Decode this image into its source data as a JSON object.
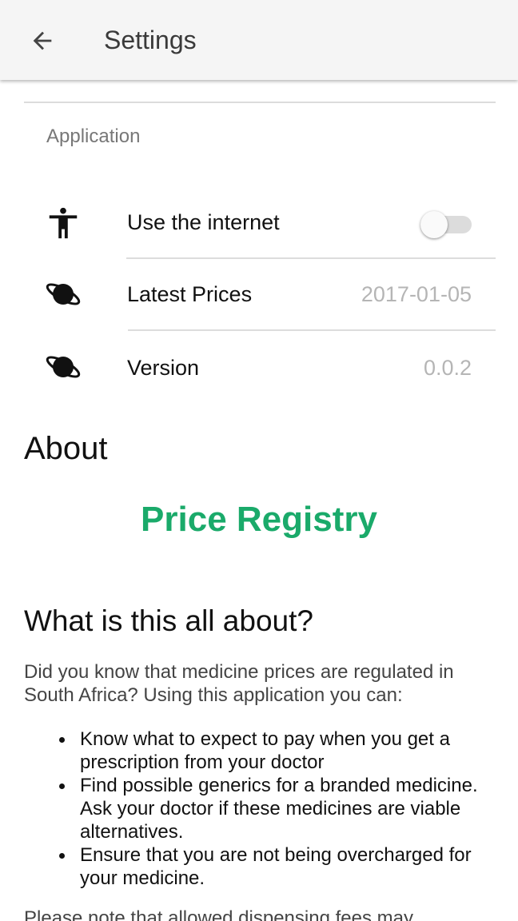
{
  "appbar": {
    "title": "Settings",
    "back_icon": "arrow-left-icon"
  },
  "settings": {
    "section_label": "Application",
    "rows": [
      {
        "label": "Use the internet",
        "icon": "accessibility-icon",
        "control": "toggle",
        "toggle_on": false
      },
      {
        "label": "Latest Prices",
        "icon": "planet-icon",
        "value": "2017-01-05"
      },
      {
        "label": "Version",
        "icon": "planet-icon",
        "value": "0.0.2"
      }
    ]
  },
  "about": {
    "title": "About",
    "brand": "Price Registry",
    "brand_color": "#1aaa6a",
    "what_title": "What is this all about?",
    "intro": "Did you know that medicine prices are regulated in South Africa? Using this application you can:",
    "bullets": [
      "Know what to expect to pay when you get a prescription from your doctor",
      "Find possible generics for a branded medicine. Ask your doctor if these medicines are viable alternatives.",
      "Ensure that you are not being overcharged for your medicine."
    ],
    "note": "Please note that allowed dispensing fees may"
  }
}
